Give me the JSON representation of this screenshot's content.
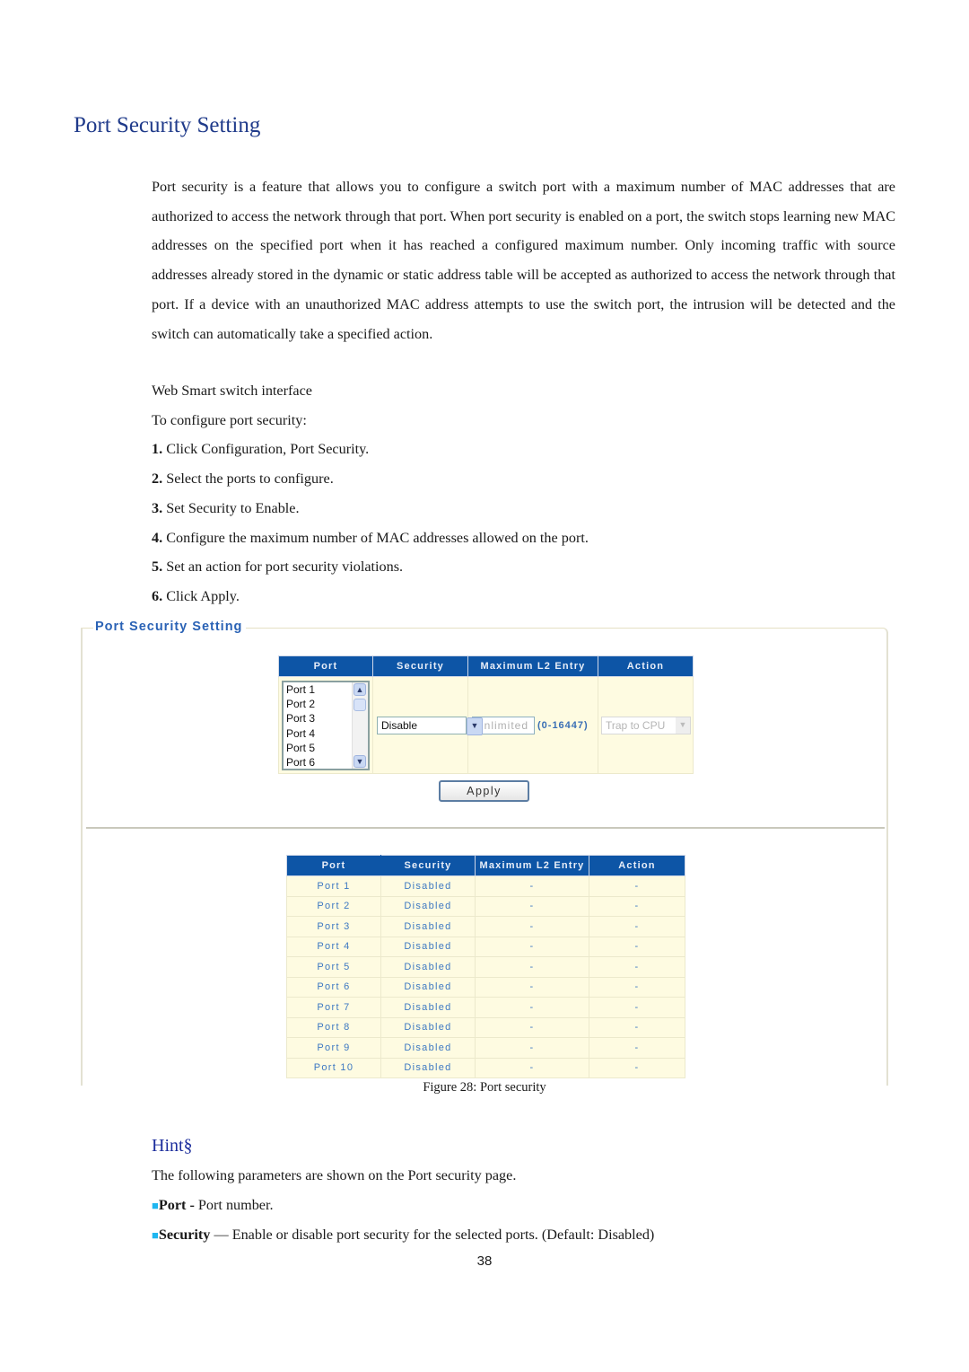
{
  "heading": "Port Security Setting",
  "intro": "Port security is a feature that allows you to configure a switch port with a maximum number of MAC addresses that are authorized to access the network through that port. When port security is enabled on a port, the switch stops learning new MAC addresses on the specified port when it has reached a configured maximum number. Only incoming traffic with source addresses already stored in the dynamic or static address table will be accepted as authorized to access the network through that port. If a device with an unauthorized MAC address attempts to use the switch port, the intrusion will be detected and the switch can automatically take a specified action.",
  "interface_label": "Web Smart switch interface",
  "steps_intro": "To configure port security:",
  "steps": [
    {
      "num": "1.",
      "text": " Click Configuration, Port Security."
    },
    {
      "num": "2.",
      "text": " Select the ports to configure."
    },
    {
      "num": "3.",
      "text": " Set Security to Enable."
    },
    {
      "num": "4.",
      "text": " Configure the maximum number of MAC addresses allowed on the port."
    },
    {
      "num": "5.",
      "text": " Set an action for port security violations."
    },
    {
      "num": "6.",
      "text": " Click Apply."
    }
  ],
  "panel": {
    "title": "Port Security Setting",
    "config_headers": [
      "Port",
      "Security",
      "Maximum L2 Entry",
      "Action"
    ],
    "port_list": [
      "Port 1",
      "Port 2",
      "Port 3",
      "Port 4",
      "Port 5",
      "Port 6"
    ],
    "security_value": "Disable",
    "max_entry_placeholder": "Unlimited",
    "max_entry_range": "(0-16447)",
    "action_value": "Trap to CPU",
    "apply_label": "Apply",
    "status_headers": [
      "Port",
      "Security",
      "Maximum L2 Entry",
      "Action"
    ],
    "status_rows": [
      [
        "Port 1",
        "Disabled",
        "-",
        "-"
      ],
      [
        "Port 2",
        "Disabled",
        "-",
        "-"
      ],
      [
        "Port 3",
        "Disabled",
        "-",
        "-"
      ],
      [
        "Port 4",
        "Disabled",
        "-",
        "-"
      ],
      [
        "Port 5",
        "Disabled",
        "-",
        "-"
      ],
      [
        "Port 6",
        "Disabled",
        "-",
        "-"
      ],
      [
        "Port 7",
        "Disabled",
        "-",
        "-"
      ],
      [
        "Port 8",
        "Disabled",
        "-",
        "-"
      ],
      [
        "Port 9",
        "Disabled",
        "-",
        "-"
      ],
      [
        "Port 10",
        "Disabled",
        "-",
        "-"
      ]
    ]
  },
  "caption": "Figure 28: Port security",
  "hint_title": "Hint§",
  "hint_intro": "The following parameters are shown on the Port security page.",
  "params": [
    {
      "bullet": "■",
      "name": "Port",
      "sep": " - ",
      "desc": "Port number."
    },
    {
      "bullet": "■",
      "name": "Security",
      "sep": " — ",
      "desc": "Enable or disable port security for the selected ports. (Default: Disabled)"
    }
  ],
  "page_number": "38"
}
